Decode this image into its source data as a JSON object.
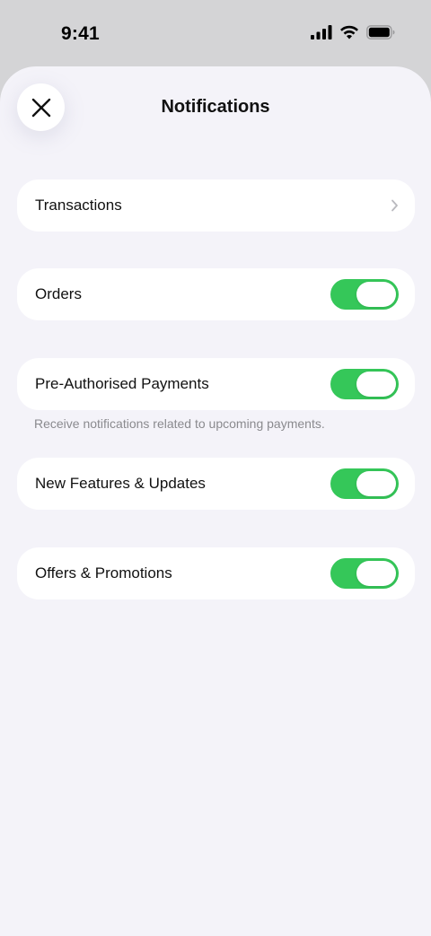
{
  "status_bar": {
    "time": "9:41"
  },
  "header": {
    "title": "Notifications",
    "close_icon": "close-icon"
  },
  "rows": [
    {
      "label": "Transactions",
      "control": "chevron"
    },
    {
      "label": "Orders",
      "control": "toggle",
      "enabled": true
    },
    {
      "label": "Pre-Authorised Payments",
      "control": "toggle",
      "enabled": true
    },
    {
      "label": "New Features & Updates",
      "control": "toggle",
      "enabled": true
    },
    {
      "label": "Offers & Promotions",
      "control": "toggle",
      "enabled": true
    }
  ],
  "captions": {
    "pre_authorised": "Receive notifications related to upcoming payments."
  },
  "colors": {
    "toggle_on": "#35c759",
    "sheet_background": "#f4f3f9",
    "status_background": "#d4d4d6"
  }
}
